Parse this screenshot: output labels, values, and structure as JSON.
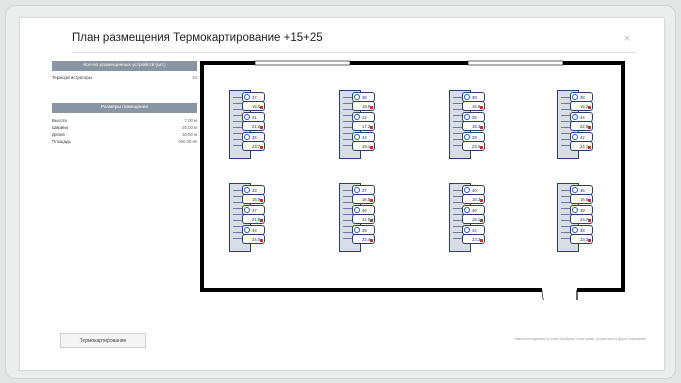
{
  "dialog": {
    "title": "План размещения Термокартирование +15+25",
    "close": "×"
  },
  "sidebar": {
    "devices_header": "Кол-во размещенных устройств (шт.)",
    "devices_row": {
      "label": "Терморегистраторы",
      "value": "24"
    },
    "room_header": "Размеры помещения",
    "room_rows": [
      {
        "label": "Высота",
        "value": "7.00 м"
      },
      {
        "label": "Ширина",
        "value": "25.00 м"
      },
      {
        "label": "Длина",
        "value": "30.00 м"
      },
      {
        "label": "Площадь",
        "value": "000.00 м²"
      }
    ]
  },
  "plan": {
    "racks": [
      {
        "sensors": [
          {
            "n": "37",
            "t": "16.0"
          },
          {
            "n": "41",
            "t": "21.0"
          },
          {
            "n": "35",
            "t": "23.7"
          }
        ]
      },
      {
        "sensors": [
          {
            "n": "35",
            "t": "18.0"
          },
          {
            "n": "42",
            "t": "17.2"
          },
          {
            "n": "43",
            "t": "19.1"
          }
        ]
      },
      {
        "sensors": [
          {
            "n": "39",
            "t": "15.9"
          },
          {
            "n": "26",
            "t": "15.4"
          },
          {
            "n": "29",
            "t": "23.4"
          }
        ]
      },
      {
        "sensors": [
          {
            "n": "38",
            "t": "16.2"
          },
          {
            "n": "44",
            "t": "22.9"
          },
          {
            "n": "42",
            "t": "24.1"
          }
        ]
      },
      {
        "sensors": [
          {
            "n": "43",
            "t": "15.9"
          },
          {
            "n": "37",
            "t": "21.9"
          },
          {
            "n": "44",
            "t": "24.0"
          }
        ]
      },
      {
        "sensors": [
          {
            "n": "37",
            "t": "16.5"
          },
          {
            "n": "45",
            "t": "22.0"
          },
          {
            "n": "39",
            "t": "23.4"
          }
        ]
      },
      {
        "sensors": [
          {
            "n": "40",
            "t": "16.3"
          },
          {
            "n": "40",
            "t": "18.1"
          },
          {
            "n": "44",
            "t": "23.3"
          }
        ]
      },
      {
        "sensors": [
          {
            "n": "45",
            "t": "16.6"
          },
          {
            "n": "39",
            "t": "24.7"
          },
          {
            "n": "38",
            "t": "23.3"
          }
        ]
      }
    ]
  },
  "footer": {
    "button": "Термокартирование",
    "note": "Напишите подсказку по плану. Выберите точки схемы, устройства на Другое помещение"
  },
  "colors": {
    "wall": "#000000",
    "rack": "#2d3f6b",
    "header_bg": "#8a95a3",
    "sensor_icon": "#1e5bd0",
    "signal": "#c0392b"
  }
}
